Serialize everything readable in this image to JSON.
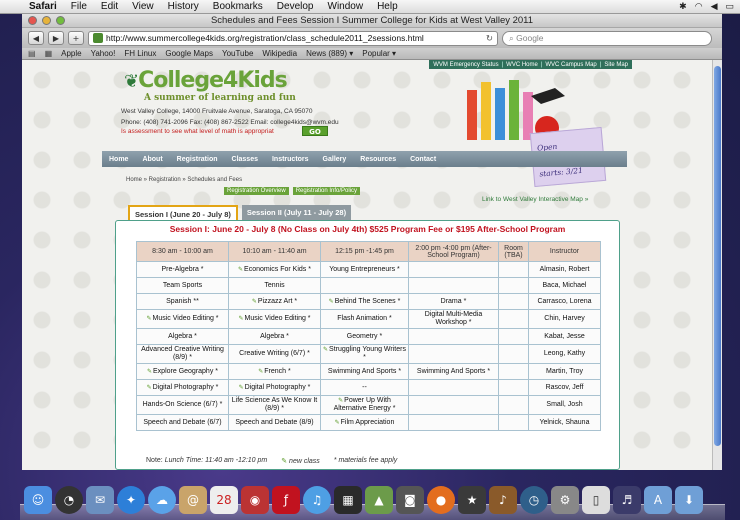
{
  "menubar": {
    "app": "Safari",
    "items": [
      "File",
      "Edit",
      "View",
      "History",
      "Bookmarks",
      "Develop",
      "Window",
      "Help"
    ]
  },
  "window": {
    "title": "Schedules and Fees Session I Summer College for Kids at West Valley 2011",
    "url": "http://www.summercollege4kids.org/registration/class_schedule2011_2sessions.html",
    "search_placeholder": "Google"
  },
  "bookmarks": [
    "Apple",
    "Yahoo!",
    "FH Linux",
    "Google Maps",
    "YouTube",
    "Wikipedia",
    "News (889) ▾",
    "Popular ▾"
  ],
  "site": {
    "top_links": [
      "WVM Emergency Status",
      "WVC Home",
      "WVC Campus Map",
      "Site Map"
    ],
    "logo": "College4Kids",
    "tagline": "A summer of learning and fun",
    "address_line1": "West Valley College, 14000 Fruitvale Avenue, Saratoga, CA 95070",
    "address_line2": "Phone: (408) 741-2096 Fax: (408) 867-2522 Email: college4kids@wvm.edu",
    "marquee": "Is assessment to see what level of math is appropriat",
    "go_label": "GO",
    "enroll_line1": "Open Enrollment",
    "enroll_line2": "starts: 3/21",
    "nav": [
      "Home",
      "About",
      "Registration",
      "Classes",
      "Instructors",
      "Gallery",
      "Resources",
      "Contact"
    ],
    "breadcrumb": "Home » Registration » Schedules and Fees",
    "pills": [
      "Registration Overview",
      "Registration Info/Policy"
    ],
    "map_link": "Link to West Valley Interactive Map »",
    "tabs": [
      "Session I (June 20 - July 8)",
      "Session II (July 11 - July 28)"
    ],
    "session_title": "Session I: June 20 - July 8 (No Class on July 4th) $525 Program Fee or $195 After-School Program"
  },
  "schedule": {
    "headers": [
      "8:30 am - 10:00 am",
      "10:10 am - 11:40 am",
      "12:15 pm -1:45 pm",
      "2:00 pm -4:00 pm (After-School Program)",
      "Room (TBA)",
      "Instructor"
    ],
    "rows": [
      {
        "cells": [
          "Pre-Algebra *",
          "Economics For Kids *",
          "Young Entrepreneurs *",
          "",
          "",
          "Almasin, Robert"
        ],
        "new": [
          false,
          true,
          false,
          false,
          false,
          false
        ]
      },
      {
        "cells": [
          "Team Sports",
          "Tennis",
          "",
          "",
          "",
          "Baca, Michael"
        ],
        "new": [
          false,
          false,
          false,
          false,
          false,
          false
        ]
      },
      {
        "cells": [
          "Spanish **",
          "Pizzazz Art *",
          "Behind The Scenes *",
          "Drama *",
          "",
          "Carrasco, Lorena"
        ],
        "new": [
          false,
          true,
          true,
          false,
          false,
          false
        ]
      },
      {
        "cells": [
          "Music Video Editing *",
          "Music Video Editing *",
          "Flash Animation *",
          "Digital Multi-Media Workshop *",
          "",
          "Chin, Harvey"
        ],
        "new": [
          true,
          true,
          false,
          false,
          false,
          false
        ]
      },
      {
        "cells": [
          "Algebra *",
          "Algebra *",
          "Geometry *",
          "",
          "",
          "Kabat, Jesse"
        ],
        "new": [
          false,
          false,
          false,
          false,
          false,
          false
        ]
      },
      {
        "cells": [
          "Advanced Creative Writing (8/9) *",
          "Creative Writing (6/7) *",
          "Struggling Young Writers *",
          "",
          "",
          "Leong, Kathy"
        ],
        "new": [
          false,
          false,
          true,
          false,
          false,
          false
        ]
      },
      {
        "cells": [
          "Explore Geography *",
          "French *",
          "Swimming And Sports *",
          "Swimming And Sports *",
          "",
          "Martin, Troy"
        ],
        "new": [
          true,
          true,
          false,
          false,
          false,
          false
        ]
      },
      {
        "cells": [
          "Digital Photography *",
          "Digital Photography *",
          "--",
          "",
          "",
          "Rascov, Jeff"
        ],
        "new": [
          true,
          true,
          false,
          false,
          false,
          false
        ]
      },
      {
        "cells": [
          "Hands-On Science (6/7) *",
          "Life Science As We Know It (8/9) *",
          "Power Up With Alternative Energy *",
          "",
          "",
          "Small, Josh"
        ],
        "new": [
          false,
          false,
          true,
          false,
          false,
          false
        ]
      },
      {
        "cells": [
          "Speech and Debate (6/7)",
          "Speech and Debate (8/9)",
          "Film Appreciation",
          "",
          "",
          "Yelnick, Shauna"
        ],
        "new": [
          false,
          false,
          true,
          false,
          false,
          false
        ]
      }
    ],
    "note_label": "Note:",
    "note_text": "Lunch Time: 11:40 am -12:10 pm",
    "legend_new": "new class",
    "legend_fee": "* materials fee apply"
  },
  "colors": {
    "accent_green": "#6aa33a",
    "session_red": "#c1121f",
    "tab_active_border": "#e3a515"
  },
  "icons": [
    "apple-icon",
    "back-icon",
    "forward-icon",
    "add-bookmark-icon",
    "reload-icon",
    "reader-icon",
    "bookmark-book-icon",
    "crayon-new-icon"
  ]
}
